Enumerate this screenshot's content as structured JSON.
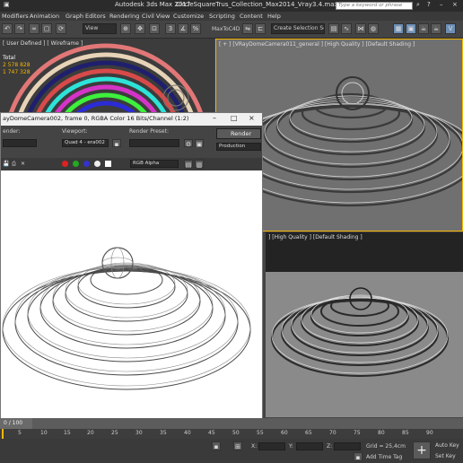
{
  "window": {
    "app_title": "Autodesk 3ds Max 2017",
    "file_title": "CircleSquareTrus_Collection_Max2014_Vray3.4.max",
    "search_placeholder": "Type a keyword or phrase"
  },
  "menu": [
    "Modifiers",
    "Animation",
    "Graph Editors",
    "Rendering",
    "Civil View",
    "Customize",
    "Scripting",
    "Content",
    "Help"
  ],
  "toolbar": {
    "view_dropdown": "View",
    "maxtoc4d": "MaxToC4D",
    "selection_set": "Create Selection Se"
  },
  "viewports": {
    "top_left_label": "[ User Defined ] [ Wireframe ]",
    "top_left_readout": [
      "Total",
      "2 578 828",
      "1 747 328"
    ],
    "right_top_label": "[ + ] [VRayDomeCamera011_general ] [High Quality ] [Default Shading ]",
    "right_bottom_label": "] [High Quality ] [Default Shading ]"
  },
  "frame_window": {
    "title": "ayDomeCamera002, frame 0, RGBA Color 16 Bits/Channel (1:2)",
    "render_area_label": "ender:",
    "viewport_label": "Viewport:",
    "viewport_value": "Quad 4 - era002",
    "render_preset_label": "Render Preset:",
    "render_button": "Render",
    "production_value": "Production",
    "channel_value": "RGB Alpha"
  },
  "timeline": {
    "frame_readout": "0 / 100",
    "ticks": [
      "5",
      "10",
      "15",
      "20",
      "25",
      "30",
      "35",
      "40",
      "45",
      "50",
      "55",
      "60",
      "65",
      "70",
      "75",
      "80",
      "85",
      "90"
    ]
  },
  "status": {
    "x_label": "X:",
    "y_label": "Y:",
    "z_label": "Z:",
    "grid": "Grid = 25,4cm",
    "add_time_tag": "Add Time Tag",
    "auto_key": "Auto Key",
    "set_key": "Set Key"
  },
  "colors": {
    "accent_yellow": "#f5b700",
    "window_bg": "#444444",
    "title_bg": "#2b2b2b"
  },
  "icons": [
    "undo-icon",
    "redo-icon",
    "link-icon",
    "select-icon",
    "move-icon",
    "rotate-icon",
    "scale-icon",
    "snap-icon",
    "mirror-icon",
    "align-icon",
    "layer-icon",
    "render-setup-icon",
    "render-frame-icon",
    "render-icon",
    "save-icon",
    "copy-icon",
    "print-icon",
    "close-icon",
    "minimize-icon",
    "maximize-icon",
    "search-icon",
    "help-icon",
    "lock-icon"
  ]
}
